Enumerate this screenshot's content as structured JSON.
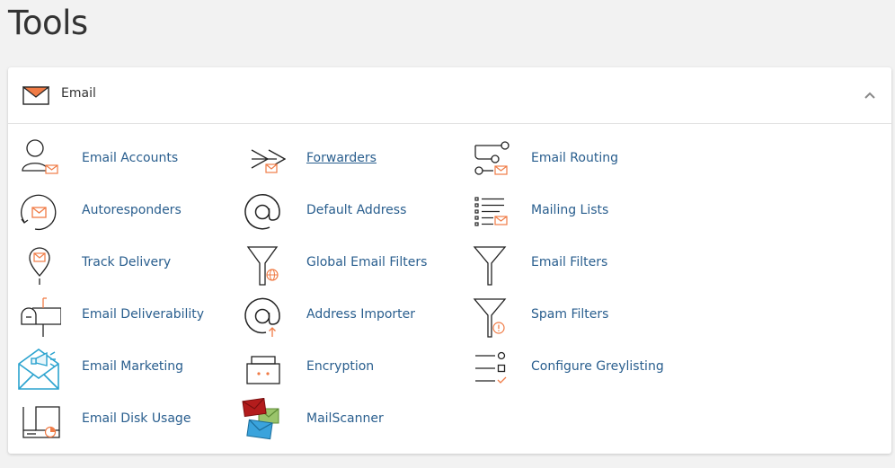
{
  "page": {
    "title": "Tools"
  },
  "section": {
    "title": "Email",
    "icon": "envelope-icon",
    "collapse_icon": "chevron-up-icon"
  },
  "colors": {
    "link": "#295e8e",
    "accent": "#f07b45",
    "icon_stroke": "#222222"
  },
  "tools": [
    {
      "label": "Email Accounts",
      "icon": "user-mail-icon"
    },
    {
      "label": "Forwarders",
      "icon": "forward-arrow-icon"
    },
    {
      "label": "Email Routing",
      "icon": "routing-icon"
    },
    {
      "label": "Autoresponders",
      "icon": "autoresponder-icon"
    },
    {
      "label": "Default Address",
      "icon": "at-sign-icon"
    },
    {
      "label": "Mailing Lists",
      "icon": "mailing-list-icon"
    },
    {
      "label": "Track Delivery",
      "icon": "map-pin-icon"
    },
    {
      "label": "Global Email Filters",
      "icon": "funnel-globe-icon"
    },
    {
      "label": "Email Filters",
      "icon": "funnel-icon"
    },
    {
      "label": "Email Deliverability",
      "icon": "mailbox-icon"
    },
    {
      "label": "Address Importer",
      "icon": "at-import-icon"
    },
    {
      "label": "Spam Filters",
      "icon": "funnel-warning-icon"
    },
    {
      "label": "Email Marketing",
      "icon": "megaphone-envelope-icon"
    },
    {
      "label": "Encryption",
      "icon": "briefcase-lock-icon"
    },
    {
      "label": "Configure Greylisting",
      "icon": "checklist-icon"
    },
    {
      "label": "Email Disk Usage",
      "icon": "disk-usage-icon"
    },
    {
      "label": "MailScanner",
      "icon": "mailscanner-icon"
    }
  ]
}
